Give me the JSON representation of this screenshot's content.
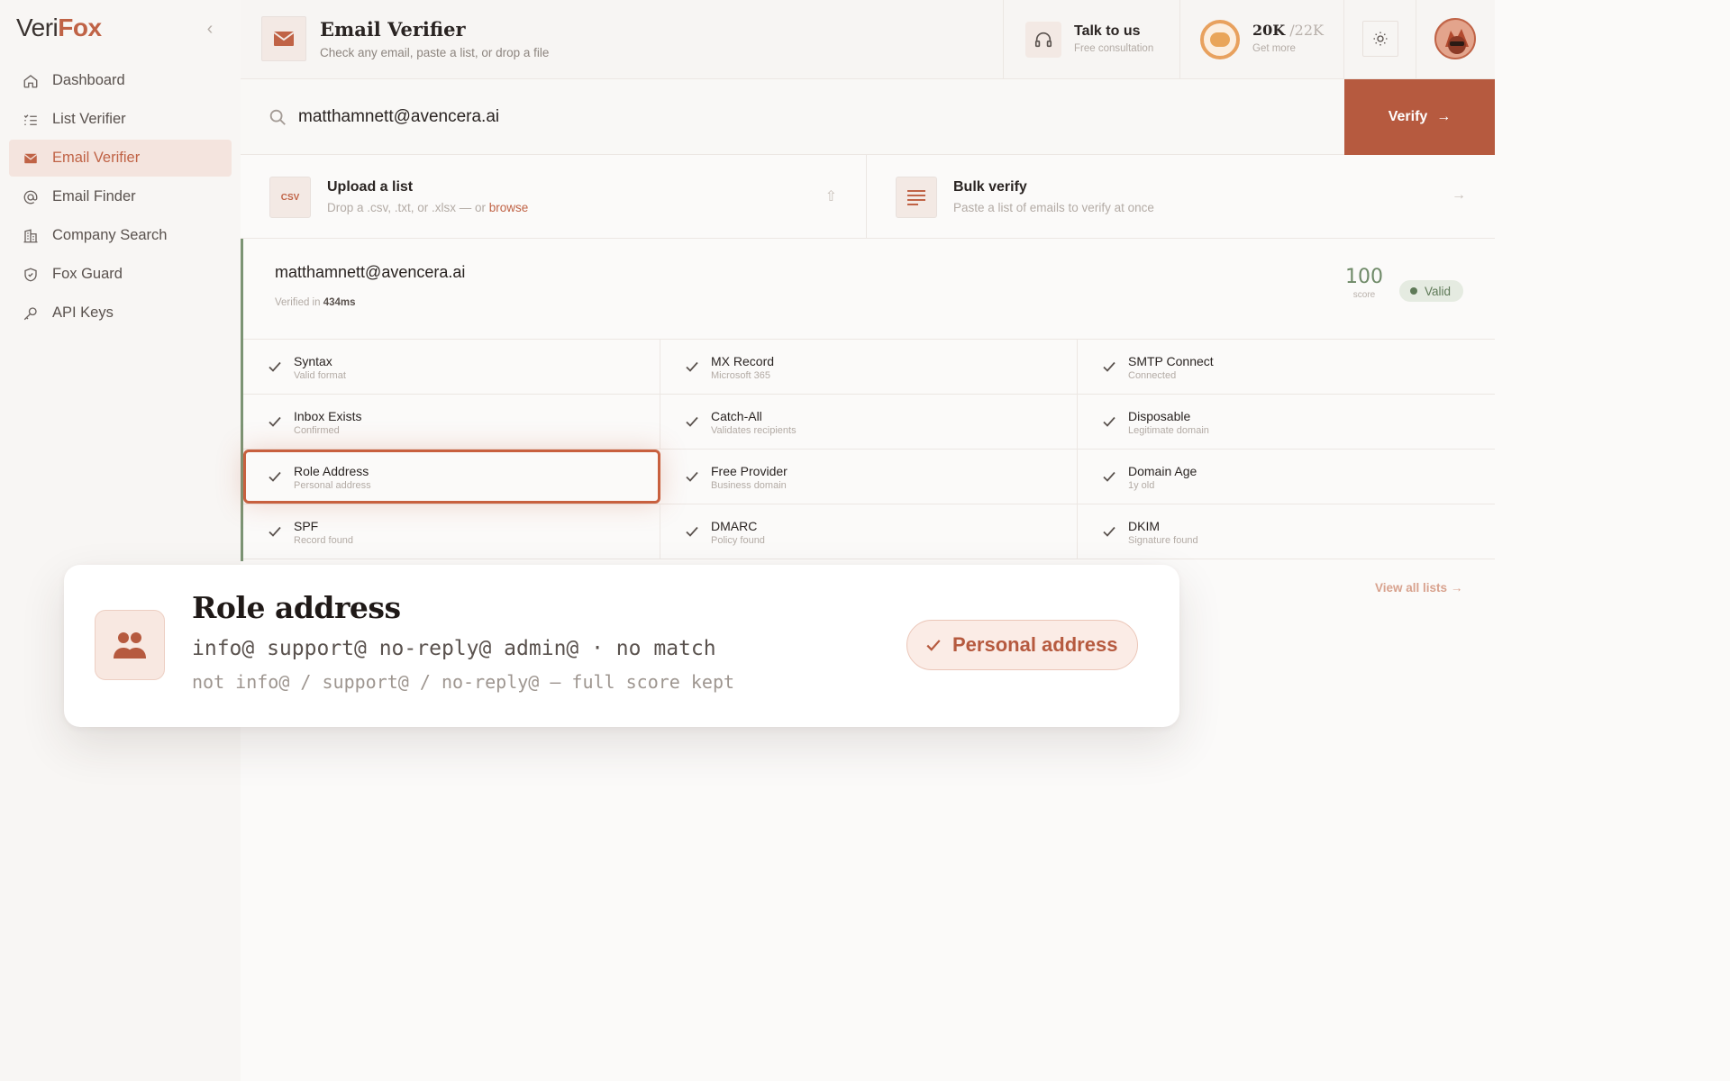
{
  "brand": {
    "part1": "Veri",
    "part2": "Fox"
  },
  "sidebar": {
    "collapse_icon": "chevron-left-icon",
    "items": [
      {
        "label": "Dashboard",
        "icon": "home-icon",
        "active": false
      },
      {
        "label": "List Verifier",
        "icon": "list-icon",
        "active": false
      },
      {
        "label": "Email Verifier",
        "icon": "mail-icon",
        "active": true
      },
      {
        "label": "Email Finder",
        "icon": "at-sign-icon",
        "active": false
      },
      {
        "label": "Company Search",
        "icon": "building-icon",
        "active": false
      },
      {
        "label": "Fox Guard",
        "icon": "shield-icon",
        "active": false
      },
      {
        "label": "API Keys",
        "icon": "key-icon",
        "active": false
      }
    ]
  },
  "header": {
    "title": "Email Verifier",
    "subtitle": "Check any email, paste a list, or drop a file",
    "talk": {
      "title": "Talk to us",
      "subtitle": "Free consultation"
    },
    "credits": {
      "value": "20K",
      "total": "/22K",
      "subtitle": "Get more"
    }
  },
  "search": {
    "value": "matthamnett@avencera.ai",
    "button_label": "Verify"
  },
  "upload": {
    "title": "Upload a list",
    "subtitle_prefix": "Drop a .csv, .txt, or .xlsx — or ",
    "link": "browse",
    "icon_text": "CSV"
  },
  "bulk": {
    "title": "Bulk verify",
    "subtitle": "Paste a list of emails to verify at once"
  },
  "result": {
    "email": "matthamnett@avencera.ai",
    "time_label": "Verified in ",
    "time_value": "434ms",
    "score": "100",
    "score_label": "score",
    "status": "Valid",
    "checks": [
      [
        {
          "title": "Syntax",
          "sub": "Valid format"
        },
        {
          "title": "MX Record",
          "sub": "Microsoft 365"
        },
        {
          "title": "SMTP Connect",
          "sub": "Connected"
        }
      ],
      [
        {
          "title": "Inbox Exists",
          "sub": "Confirmed"
        },
        {
          "title": "Catch-All",
          "sub": "Validates recipients"
        },
        {
          "title": "Disposable",
          "sub": "Legitimate domain"
        }
      ],
      [
        {
          "title": "Role Address",
          "sub": "Personal address"
        },
        {
          "title": "Free Provider",
          "sub": "Business domain"
        },
        {
          "title": "Domain Age",
          "sub": "1y old"
        }
      ],
      [
        {
          "title": "SPF",
          "sub": "Record found"
        },
        {
          "title": "DMARC",
          "sub": "Policy found"
        },
        {
          "title": "DKIM",
          "sub": "Signature found"
        }
      ]
    ]
  },
  "view_all": "View all lists",
  "popup": {
    "title": "Role address",
    "line1": "info@ support@ no-reply@ admin@ · no match",
    "line2": "not info@ / support@ / no-reply@ — full score kept",
    "badge": "Personal address",
    "icon": "users-icon"
  },
  "colors": {
    "accent": "#b65a3f",
    "valid": "#5f7a58"
  }
}
